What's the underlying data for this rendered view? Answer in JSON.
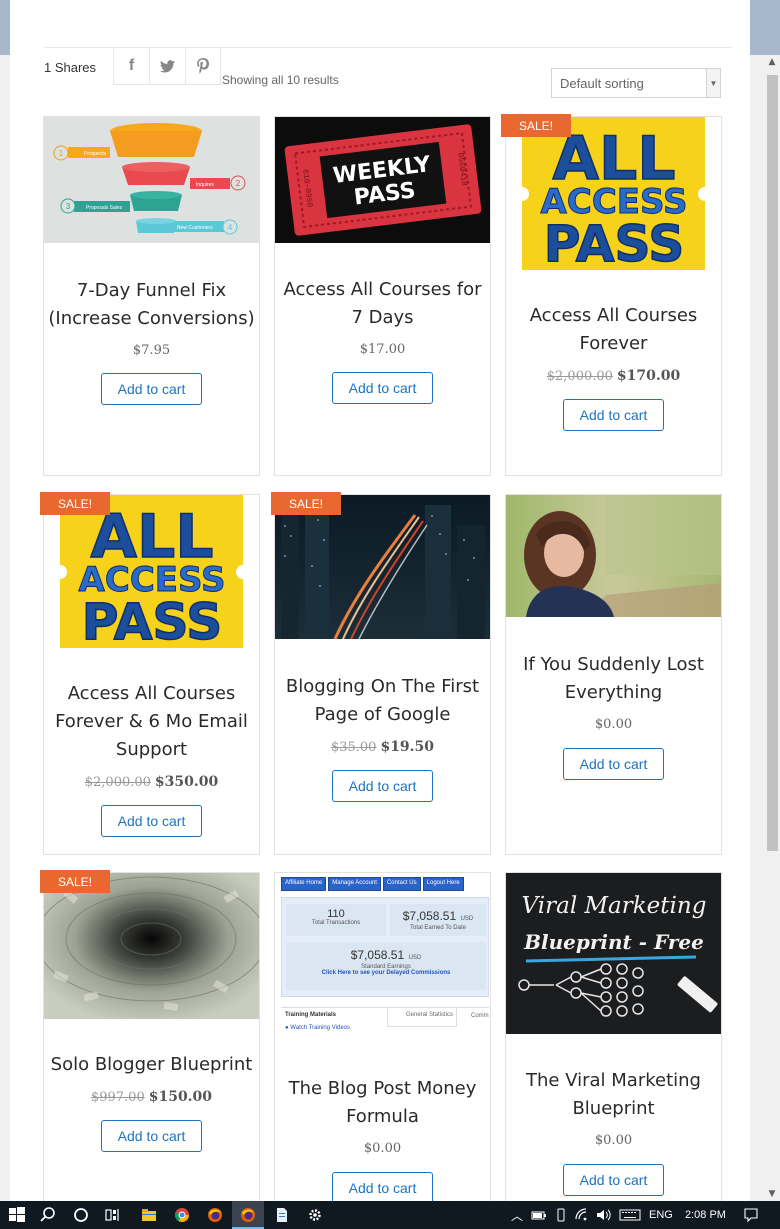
{
  "share_bar": {
    "shares_label": "1 Shares",
    "icons": [
      "facebook-icon",
      "twitter-icon",
      "pinterest-icon"
    ]
  },
  "results_text": "Showing all 10 results",
  "sorting": {
    "selected": "Default sorting"
  },
  "sale_badge": "SALE!",
  "add_to_cart_label": "Add to cart",
  "products": [
    {
      "title_lines": [
        "7-Day Funnel Fix",
        "(Increase Conversions)"
      ],
      "price_old": "",
      "price": "$7.95",
      "sale": false,
      "image": "funnel-diagram",
      "image_labels": [
        "1",
        "Prospects",
        "2",
        "Inquires",
        "3",
        "Proposals Sales",
        "4",
        "New Customers"
      ]
    },
    {
      "title_lines": [
        "Access All Courses for",
        "7 Days"
      ],
      "price_old": "",
      "price": "$17.00",
      "sale": false,
      "image": "weekly-pass-ticket",
      "image_text": [
        "WEEKLY",
        "PASS"
      ],
      "image_numbers": [
        "610-0950",
        "0560418"
      ]
    },
    {
      "title_lines": [
        "Access All Courses",
        "Forever"
      ],
      "price_old": "$2,000.00",
      "price": "$170.00",
      "sale": true,
      "image": "all-access-pass",
      "image_text": [
        "ALL",
        "ACCESS",
        "PASS"
      ]
    },
    {
      "title_lines": [
        "Access All Courses",
        "Forever & 6 Mo Email",
        "Support"
      ],
      "price_old": "$2,000.00",
      "price": "$350.00",
      "sale": true,
      "image": "all-access-pass",
      "image_text": [
        "ALL",
        "ACCESS",
        "PASS"
      ]
    },
    {
      "title_lines": [
        "Blogging On The First",
        "Page of Google"
      ],
      "price_old": "$35.00",
      "price": "$19.50",
      "sale": true,
      "image": "city-night-traffic"
    },
    {
      "title_lines": [
        "If You Suddenly Lost",
        "Everything"
      ],
      "price_old": "",
      "price": "$0.00",
      "sale": false,
      "image": "sad-woman-photo"
    },
    {
      "title_lines": [
        "Solo Blogger Blueprint"
      ],
      "price_old": "$997.00",
      "price": "$150.00",
      "sale": true,
      "image": "money-vortex"
    },
    {
      "title_lines": [
        "The Blog Post Money",
        "Formula"
      ],
      "price_old": "",
      "price": "$0.00",
      "sale": false,
      "image": "affiliate-dashboard",
      "dashboard": {
        "nav": [
          "Affiliate Home",
          "Manage Account",
          "Contact Us",
          "Logout Here"
        ],
        "transactions": "110",
        "transactions_label": "Total Transactions",
        "earned": "$7,058.51",
        "earned_unit": "USD",
        "earned_label": "Total Earned To Date",
        "standard": "$7,058.51",
        "standard_unit": "USD",
        "standard_label": "Standard Earnings",
        "delayed_link": "Click Here to see your Delayed Commissions",
        "training_title": "Training Materials",
        "training_link": "Watch Training Videos",
        "tab_general": "General Statistics",
        "tab_comm": "Comm"
      }
    },
    {
      "title_lines": [
        "The Viral Marketing",
        "Blueprint"
      ],
      "price_old": "",
      "price": "$0.00",
      "sale": false,
      "image": "chalkboard-viral",
      "image_text": [
        "Viral Marketing",
        "Blueprint - Free"
      ]
    }
  ],
  "taskbar": {
    "language": "ENG",
    "time": "2:08 PM"
  },
  "colors": {
    "accent_button": "#1e73be",
    "sale_badge": "#e9682f",
    "top_band": "#a7b8cc",
    "taskbar": "#101820"
  }
}
